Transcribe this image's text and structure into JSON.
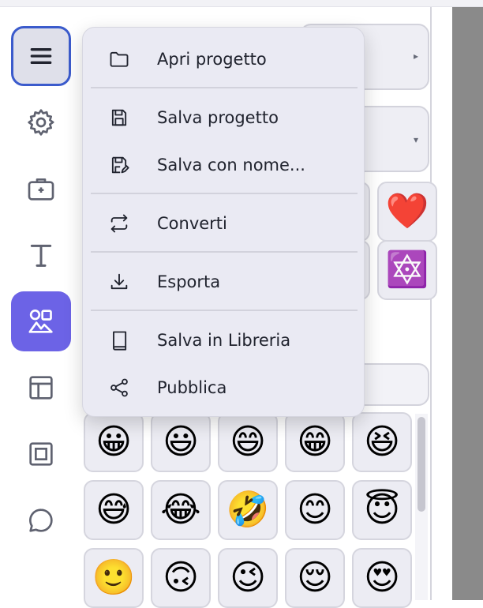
{
  "menu": {
    "items": [
      {
        "label": "Apri progetto",
        "icon": "folder-icon"
      },
      {
        "label": "Salva progetto",
        "icon": "save-icon"
      },
      {
        "label": "Salva con nome...",
        "icon": "save-as-icon"
      },
      {
        "label": "Converti",
        "icon": "convert-icon"
      },
      {
        "label": "Esporta",
        "icon": "download-icon"
      },
      {
        "label": "Salva in Libreria",
        "icon": "book-icon"
      },
      {
        "label": "Pubblica",
        "icon": "share-icon"
      }
    ]
  },
  "sidebar": {
    "buttons": [
      {
        "name": "menu",
        "icon": "hamburger-icon"
      },
      {
        "name": "settings",
        "icon": "gear-icon"
      },
      {
        "name": "toolbox",
        "icon": "briefcase-icon"
      },
      {
        "name": "text",
        "icon": "text-icon"
      },
      {
        "name": "elements",
        "icon": "shapes-icon"
      },
      {
        "name": "layout",
        "icon": "layout-icon"
      },
      {
        "name": "frame",
        "icon": "frame-icon"
      },
      {
        "name": "comments",
        "icon": "chat-bubble-icon"
      }
    ]
  },
  "panel": {
    "dropdown1_caret": "▸",
    "dropdown2_caret": "▾",
    "top_tiles": [
      "❤️",
      "🔯"
    ],
    "emoji_grid": [
      [
        "😀",
        "😃",
        "😄",
        "😁",
        "😆"
      ],
      [
        "😅",
        "😂",
        "🤣",
        "😊",
        "😇"
      ],
      [
        "🙂",
        "🙃",
        "😉",
        "😌",
        "😍"
      ]
    ]
  },
  "colors": {
    "accent": "#6c63e6",
    "menu_focus": "#3b5bcc"
  }
}
